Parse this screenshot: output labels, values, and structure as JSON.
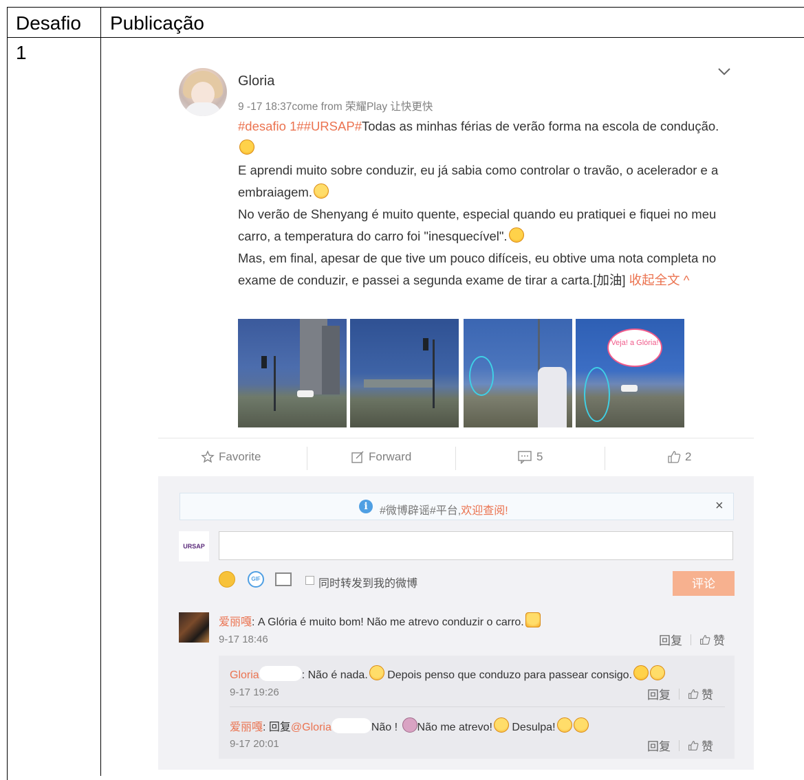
{
  "table": {
    "col1_header": "Desafio",
    "col2_header": "Publicação",
    "row1_id": "1"
  },
  "post": {
    "username": "Gloria",
    "meta": "9 -17 18:37come from 荣耀Play 让快更快",
    "tag": "#desafio 1##URSAP#",
    "line1": "Todas as minhas férias de verão forma na escola de condução.",
    "line2": "E aprendi muito sobre conduzir, eu já sabia como controlar o travão, o acelerador e a embraiagem.",
    "line3": "No verão de Shenyang é muito quente, especial quando eu pratiquei e fiquei no meu carro, a temperatura do carro foi \"inesquecível\".",
    "line4": "Mas, em final, apesar de que tive um pouco difíceis, eu obtive uma nota completa no exame de conduzir, e passei a segunda exame de tirar a carta.[加油]",
    "collapse_link": "收起全文 ^",
    "photo4_bubble": "Veja! a Glória!"
  },
  "actions": {
    "favorite": "Favorite",
    "forward": "Forward",
    "comments": "5",
    "likes": "2"
  },
  "comments_section": {
    "notice_tag": "#微博辟谣#平台,",
    "notice_link": "欢迎查阅!",
    "notice_close": "×",
    "logo_text": "URSAP",
    "input_placeholder": "",
    "also_repost_label": "同时转发到我的微博",
    "submit_label": "评论",
    "reply_label": "回复",
    "like_label": "赞",
    "items": [
      {
        "name": "爱丽嘎",
        "text": ": A Glória é muito bom! Não me atrevo conduzir o carro.",
        "time": "9-17 18:46"
      }
    ],
    "replies": [
      {
        "name": "Gloria",
        "text_before": ":  Não é nada.",
        "text_after": " Depois penso que conduzo para passear consigo.",
        "time": "9-17 19:26"
      },
      {
        "name": "爱丽嘎",
        "text_reply": ": 回复",
        "mention": "@Gloria",
        "text_main": "Não ! ",
        "text_main2": "Não me atrevo!",
        "text_end": " Desulpa!",
        "time": "9-17 20:01"
      }
    ]
  }
}
